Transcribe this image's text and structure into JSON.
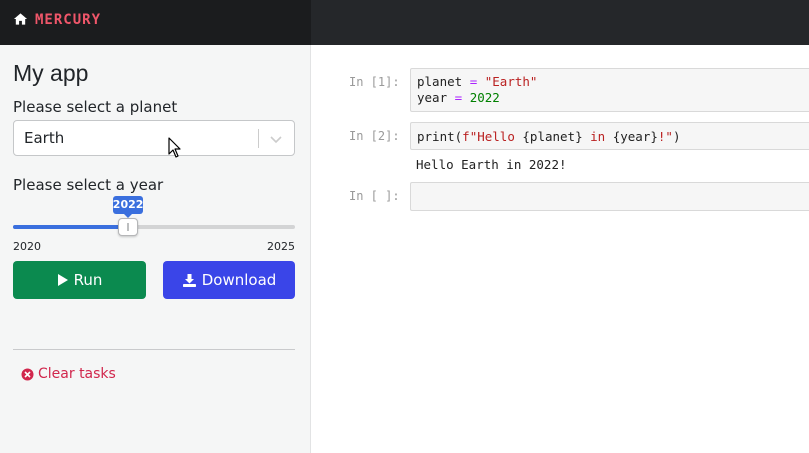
{
  "header": {
    "brand": "MERCURY",
    "brand_color": "#f0566a"
  },
  "sidebar": {
    "title": "My app",
    "planet": {
      "label": "Please select a planet",
      "value": "Earth"
    },
    "year": {
      "label": "Please select a year",
      "min": 2020,
      "max": 2025,
      "value": 2022,
      "min_label": "2020",
      "max_label": "2025",
      "value_label": "2022"
    },
    "run_label": "Run",
    "download_label": "Download",
    "clear_tasks_label": "Clear tasks",
    "colors": {
      "run": "#0b8a4f",
      "download": "#3a45e8",
      "clear_tasks": "#d1274d",
      "slider": "#3a6fde"
    }
  },
  "notebook": {
    "cells": [
      {
        "prompt": "In [1]:",
        "lines": [
          "planet = \"Earth\"",
          "year = 2022"
        ]
      },
      {
        "prompt": "In [2]:",
        "lines": [
          "print(f\"Hello {planet} in {year}!\")"
        ],
        "output": "Hello Earth in 2022!"
      },
      {
        "prompt": "In [ ]:",
        "lines": []
      }
    ]
  },
  "icons": [
    "home-icon",
    "chevron-down-icon",
    "play-icon",
    "download-icon",
    "close-circle-icon",
    "mouse-cursor-icon"
  ]
}
